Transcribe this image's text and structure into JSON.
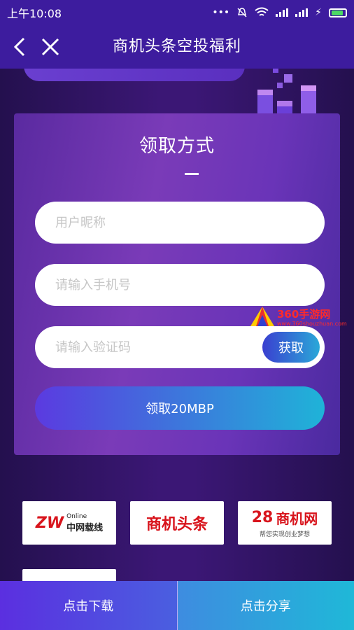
{
  "status_bar": {
    "time": "上午10:08"
  },
  "nav": {
    "title": "商机头条空投福利"
  },
  "form": {
    "title": "领取方式",
    "nickname_placeholder": "用户昵称",
    "phone_placeholder": "请输入手机号",
    "code_placeholder": "请输入验证码",
    "get_code_label": "获取",
    "claim_label": "领取20MBP"
  },
  "watermark": {
    "name": "360手游网",
    "url": "www.360shouzhuan.com"
  },
  "partners": [
    {
      "mark": "ZW",
      "name": "中网载线",
      "sub": "Online"
    },
    {
      "name": "商机头条"
    },
    {
      "mark": "28",
      "name": "商机网",
      "sub": "帮您实现创业梦想"
    }
  ],
  "bottom": {
    "download_label": "点击下载",
    "share_label": "点击分享"
  },
  "colors": {
    "header": "#3d1c9e",
    "accent_start": "#5b3ae0",
    "accent_end": "#1fb3d8",
    "brand_red": "#d8141c"
  }
}
